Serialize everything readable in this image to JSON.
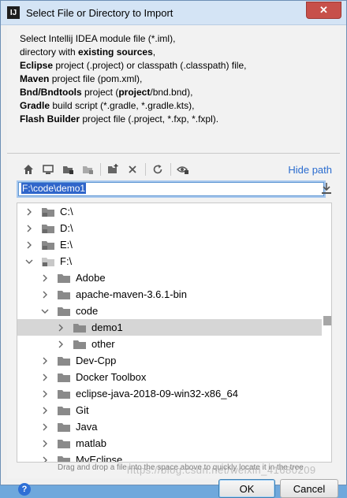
{
  "window": {
    "app_icon_text": "IJ",
    "title": "Select File or Directory to Import",
    "close_glyph": "✕"
  },
  "description": {
    "l1": "Select Intellij IDEA module file (*.iml),",
    "l2a": "directory with ",
    "l2b": "existing sources",
    "l2c": ",",
    "l3a": "Eclipse",
    "l3b": " project (.project) or classpath (.classpath) file,",
    "l4a": "Maven",
    "l4b": " project file (pom.xml),",
    "l5a": "Bnd/Bndtools",
    "l5b": " project (",
    "l5c": "project",
    "l5d": "/bnd.bnd),",
    "l6a": "Gradle",
    "l6b": " build script (*.gradle, *.gradle.kts),",
    "l7a": "Flash Builder",
    "l7b": " project file (.project, *.fxp, *.fxpl)."
  },
  "toolbar": {
    "icons": [
      "home-icon",
      "desktop-icon",
      "project-folder-icon",
      "module-folder-icon",
      "new-folder-icon",
      "delete-icon",
      "refresh-icon",
      "show-hidden-icon"
    ],
    "hide_path": "Hide path"
  },
  "path": {
    "value": "F:\\code\\demo1"
  },
  "tree": {
    "rows": [
      {
        "label": "C:\\",
        "expanded": false,
        "depth": 0,
        "type": "drive"
      },
      {
        "label": "D:\\",
        "expanded": false,
        "depth": 0,
        "type": "drive"
      },
      {
        "label": "E:\\",
        "expanded": false,
        "depth": 0,
        "type": "drive"
      },
      {
        "label": "F:\\",
        "expanded": true,
        "depth": 0,
        "type": "drive"
      },
      {
        "label": "Adobe",
        "expanded": false,
        "depth": 1,
        "type": "folder"
      },
      {
        "label": "apache-maven-3.6.1-bin",
        "expanded": false,
        "depth": 1,
        "type": "folder"
      },
      {
        "label": "code",
        "expanded": true,
        "depth": 1,
        "type": "folder"
      },
      {
        "label": "demo1",
        "expanded": false,
        "depth": 2,
        "type": "folder",
        "selected": true
      },
      {
        "label": "other",
        "expanded": false,
        "depth": 2,
        "type": "folder"
      },
      {
        "label": "Dev-Cpp",
        "expanded": false,
        "depth": 1,
        "type": "folder"
      },
      {
        "label": "Docker Toolbox",
        "expanded": false,
        "depth": 1,
        "type": "folder"
      },
      {
        "label": "eclipse-java-2018-09-win32-x86_64",
        "expanded": false,
        "depth": 1,
        "type": "folder"
      },
      {
        "label": "Git",
        "expanded": false,
        "depth": 1,
        "type": "folder"
      },
      {
        "label": "Java",
        "expanded": false,
        "depth": 1,
        "type": "folder"
      },
      {
        "label": "matlab",
        "expanded": false,
        "depth": 1,
        "type": "folder"
      },
      {
        "label": "MyEclipse",
        "expanded": false,
        "depth": 1,
        "type": "folder"
      }
    ]
  },
  "hint": "Drag and drop a file into the space above to quickly locate it in the tree",
  "buttons": {
    "help": "?",
    "ok": "OK",
    "cancel": "Cancel"
  },
  "watermark": "https://blog.csdn.net/weixin_41680209",
  "colors": {
    "accent": "#2f65ca",
    "link": "#2a6ccf",
    "selected_row": "#d6d6d6"
  }
}
